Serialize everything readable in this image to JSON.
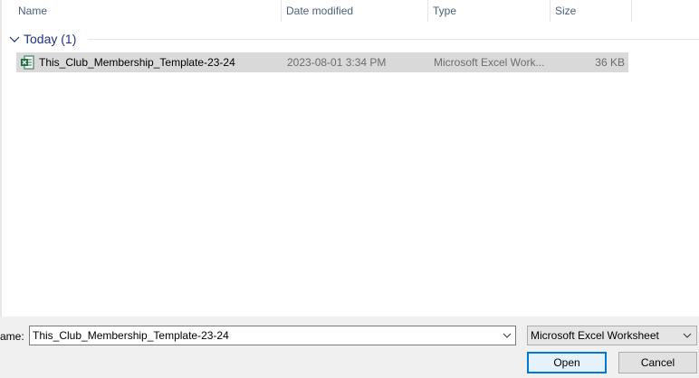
{
  "columns": {
    "name": "Name",
    "date_modified": "Date modified",
    "type": "Type",
    "size": "Size"
  },
  "group": {
    "label": "Today (1)"
  },
  "files": [
    {
      "name": "This_Club_Membership_Template-23-24",
      "date_modified": "2023-08-01 3:34 PM",
      "type": "Microsoft Excel Work...",
      "size": "36 KB",
      "icon": "excel-file-icon"
    }
  ],
  "footer": {
    "file_name_label": "ame:",
    "file_name_value": "This_Club_Membership_Template-23-24",
    "file_type_selected": "Microsoft Excel Worksheet",
    "open_label": "Open",
    "cancel_label": "Cancel"
  },
  "colors": {
    "header_text": "#4c607a",
    "group_text": "#1e3287",
    "selected_row": "#d9d9d9",
    "accent": "#0078d7",
    "excel_green": "#1d6f42"
  }
}
